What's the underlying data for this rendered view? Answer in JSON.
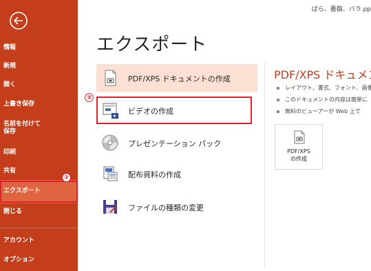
{
  "window": {
    "file_title": "ばら、薔薇、バラ.pp"
  },
  "sidebar": {
    "back_icon": "back-arrow-icon",
    "items": [
      {
        "label": "情報"
      },
      {
        "label": "新規"
      },
      {
        "label": "開く"
      },
      {
        "label": "上書き保存"
      },
      {
        "label": "名前を付けて\n保存"
      },
      {
        "label": "印刷"
      },
      {
        "label": "共有"
      },
      {
        "label": "エクスポート",
        "selected": true
      },
      {
        "label": "閉じる"
      },
      {
        "label": "アカウント"
      },
      {
        "label": "オプション"
      }
    ]
  },
  "annotations": {
    "step2": "②",
    "step3": "③"
  },
  "main": {
    "title": "エクスポート",
    "options": [
      {
        "label": "PDF/XPS ドキュメントの作成",
        "icon": "pdf-document-icon",
        "selected": true
      },
      {
        "label": "ビデオの作成",
        "icon": "video-icon"
      },
      {
        "label": "プレゼンテーション パック",
        "icon": "cd-package-icon"
      },
      {
        "label": "配布資料の作成",
        "icon": "handout-icon"
      },
      {
        "label": "ファイルの種類の変更",
        "icon": "file-type-icon"
      }
    ]
  },
  "right_panel": {
    "title": "PDF/XPS ドキュメン",
    "bullets": [
      "レイアウト、書式、フォント、画像",
      "このドキュメントの内容は簡単に",
      "無料のビューアーが Web 上で"
    ],
    "button_label": "PDF/XPS\nの作成",
    "button_icon": "pdf-icon"
  },
  "colors": {
    "sidebar": "#c43e1c",
    "selected_nav": "#e0643f",
    "highlight": "#fbe0d3",
    "annotation_red": "#e0202a"
  }
}
